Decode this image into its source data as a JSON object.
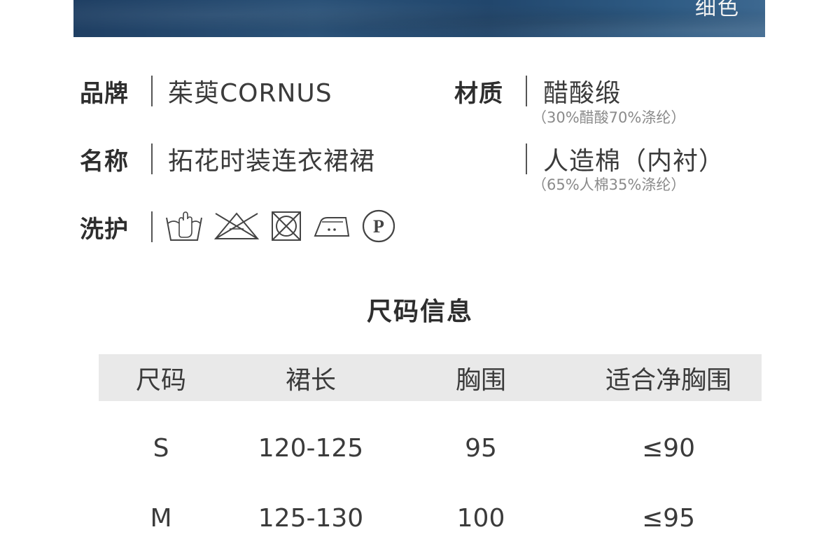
{
  "banner": {
    "text": "细色"
  },
  "specs": {
    "brand": {
      "label": "品牌",
      "value": "茱萸CORNUS"
    },
    "material": {
      "label": "材质",
      "value": "醋酸缎",
      "composition": "（30%醋酸70%涤纶）",
      "lining": "人造棉（内衬）",
      "lining_composition": "（65%人棉35%涤纶）"
    },
    "name": {
      "label": "名称",
      "value": "拓花时装连衣裙裙"
    },
    "care": {
      "label": "洗护",
      "icons": [
        "hand-wash-icon",
        "do-not-bleach-icon",
        "do-not-tumble-dry-icon",
        "iron-low-heat-icon",
        "dry-clean-p-icon"
      ],
      "dry_clean_letter": "P"
    }
  },
  "size_info": {
    "title": "尺码信息",
    "headers": [
      "尺码",
      "裙长",
      "胸围",
      "适合净胸围"
    ],
    "rows": [
      [
        "S",
        "120-125",
        "95",
        "≤90"
      ],
      [
        "M",
        "125-130",
        "100",
        "≤95"
      ]
    ]
  }
}
